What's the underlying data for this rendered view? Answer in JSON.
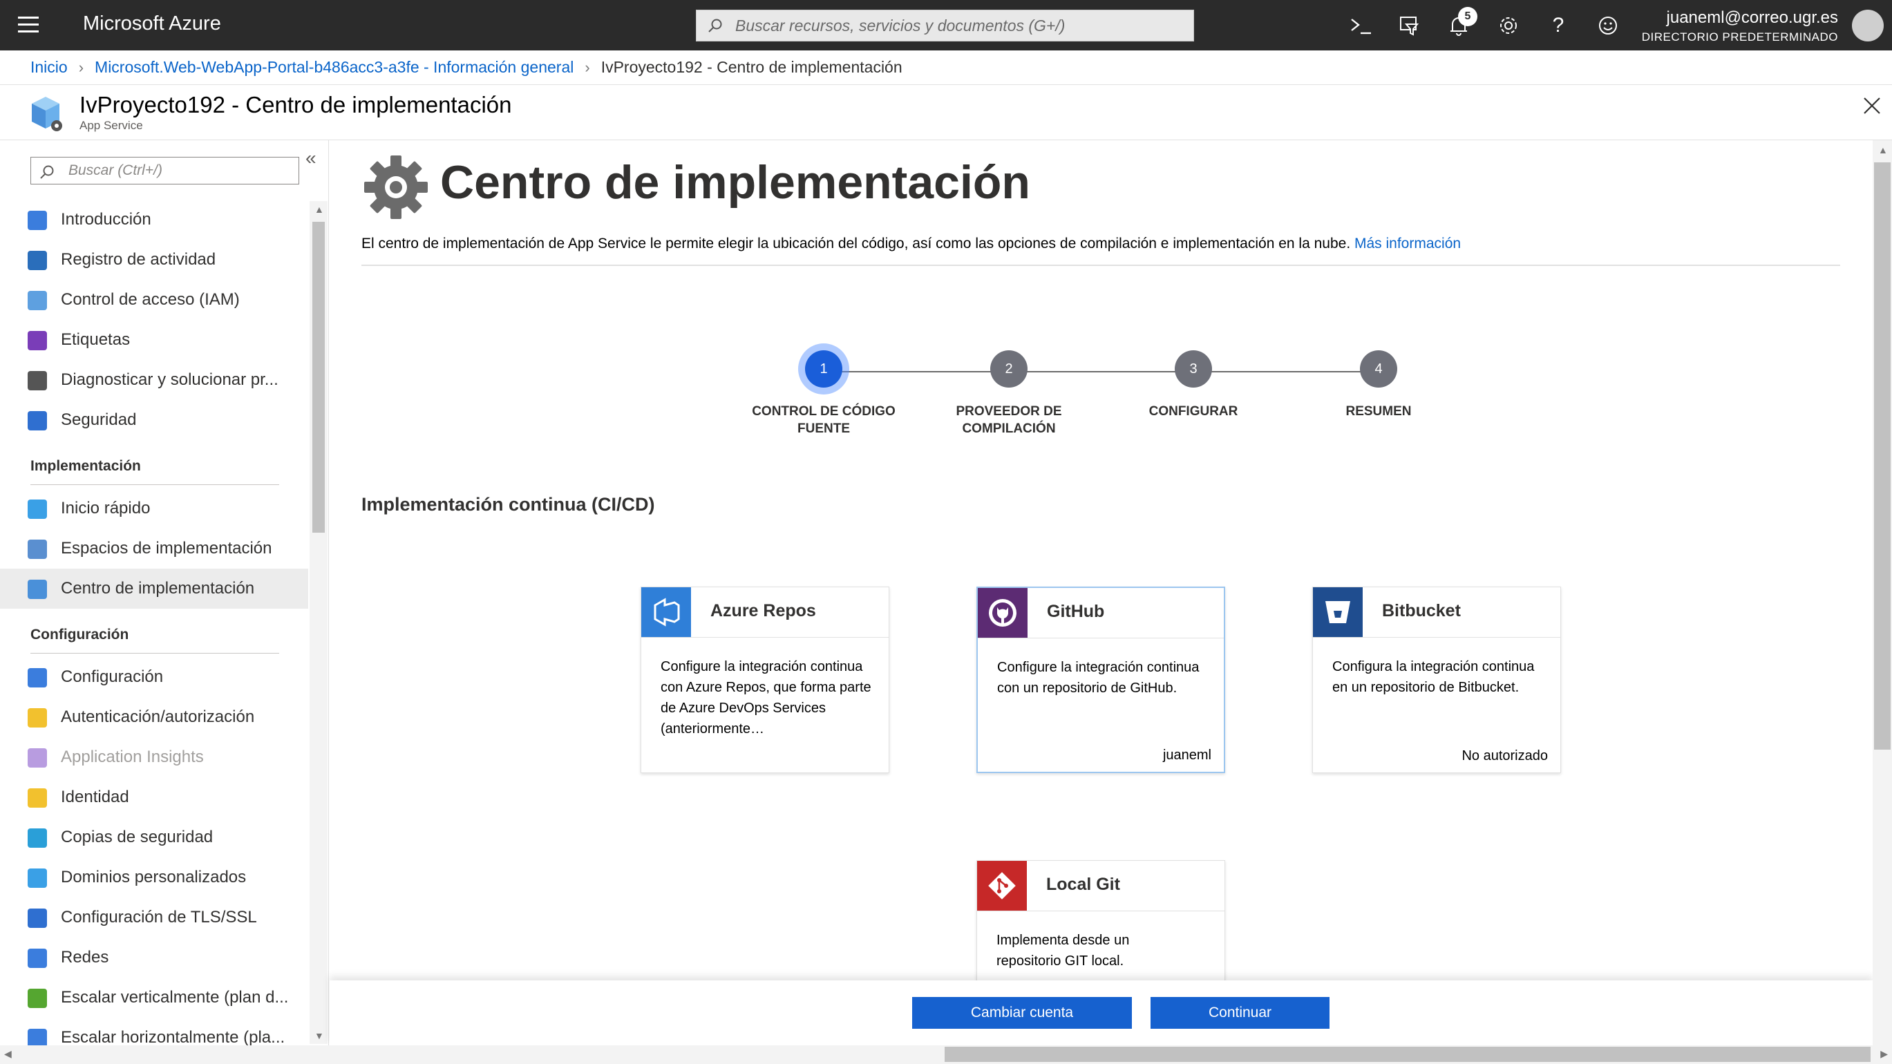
{
  "topbar": {
    "brand": "Microsoft Azure",
    "search_placeholder": "Buscar recursos, servicios y documentos (G+/)",
    "notifications_count": "5",
    "user_email": "juaneml@correo.ugr.es",
    "user_directory": "DIRECTORIO PREDETERMINADO",
    "icons": [
      "cloud-shell-icon",
      "directory-filter-icon",
      "bell-icon",
      "gear-icon",
      "help-icon",
      "feedback-smiley-icon"
    ]
  },
  "breadcrumb": {
    "home": "Inicio",
    "parent": "Microsoft.Web-WebApp-Portal-b486acc3-a3fe - Información general",
    "current": "IvProyecto192 - Centro de implementación"
  },
  "resource": {
    "title": "IvProyecto192 - Centro de implementación",
    "subtitle": "App Service"
  },
  "sidebar": {
    "search_placeholder": "Buscar (Ctrl+/)",
    "items_top": [
      {
        "label": "Introducción",
        "icon": "overview-icon",
        "color": "#3b7ddd"
      },
      {
        "label": "Registro de actividad",
        "icon": "activity-log-icon",
        "color": "#2a6ebb"
      },
      {
        "label": "Control de acceso (IAM)",
        "icon": "iam-icon",
        "color": "#5ea0e0"
      },
      {
        "label": "Etiquetas",
        "icon": "tag-icon",
        "color": "#7a3db8"
      },
      {
        "label": "Diagnosticar y solucionar pr...",
        "icon": "wrench-icon",
        "color": "#555555"
      },
      {
        "label": "Seguridad",
        "icon": "shield-icon",
        "color": "#2f6fd0"
      }
    ],
    "group_impl": "Implementación",
    "items_impl": [
      {
        "label": "Inicio rápido",
        "icon": "quickstart-icon",
        "color": "#3aa0e6"
      },
      {
        "label": "Espacios de implementación",
        "icon": "deployment-slots-icon",
        "color": "#5a8fd0"
      },
      {
        "label": "Centro de implementación",
        "icon": "deployment-center-icon",
        "color": "#4a90d9"
      }
    ],
    "group_config": "Configuración",
    "items_config": [
      {
        "label": "Configuración",
        "icon": "config-sliders-icon",
        "color": "#3b7ddd"
      },
      {
        "label": "Autenticación/autorización",
        "icon": "key-icon",
        "color": "#f2c12e"
      },
      {
        "label": "Application Insights",
        "icon": "insights-bulb-icon",
        "color": "#b89ce0"
      },
      {
        "label": "Identidad",
        "icon": "identity-icon",
        "color": "#f2c12e"
      },
      {
        "label": "Copias de seguridad",
        "icon": "backup-icon",
        "color": "#2a9fd8"
      },
      {
        "label": "Dominios personalizados",
        "icon": "domains-icon",
        "color": "#3aa0e6"
      },
      {
        "label": "Configuración de TLS/SSL",
        "icon": "tls-shield-icon",
        "color": "#2f6fd0"
      },
      {
        "label": "Redes",
        "icon": "network-icon",
        "color": "#3b7ddd"
      },
      {
        "label": "Escalar verticalmente (plan d...",
        "icon": "scale-up-icon",
        "color": "#55a630"
      },
      {
        "label": "Escalar horizontalmente (pla...",
        "icon": "scale-out-icon",
        "color": "#3b7ddd"
      }
    ]
  },
  "main": {
    "title": "Centro de implementación",
    "intro": "El centro de implementación de App Service le permite elegir la ubicación del código, así como las opciones de compilación e implementación en la nube.",
    "intro_link": "Más información",
    "steps": [
      {
        "num": "1",
        "label": "CONTROL DE CÓDIGO FUENTE",
        "active": true
      },
      {
        "num": "2",
        "label": "PROVEEDOR DE COMPILACIÓN",
        "active": false
      },
      {
        "num": "3",
        "label": "CONFIGURAR",
        "active": false
      },
      {
        "num": "4",
        "label": "RESUMEN",
        "active": false
      }
    ],
    "section_title": "Implementación continua (CI/CD)",
    "cards": [
      {
        "title": "Azure Repos",
        "desc": "Configure la integración continua con Azure Repos, que forma parte de Azure DevOps Services (anteriormente…",
        "status": "",
        "icon": "azure-repos-icon",
        "color": "#2f7fd8"
      },
      {
        "title": "GitHub",
        "desc": "Configure la integración continua con un repositorio de GitHub.",
        "status": "juaneml",
        "icon": "github-icon",
        "color": "#5c2b73"
      },
      {
        "title": "Bitbucket",
        "desc": "Configura la integración continua en un repositorio de Bitbucket.",
        "status": "No autorizado",
        "icon": "bitbucket-icon",
        "color": "#1f4d8f"
      },
      {
        "title": "Local Git",
        "desc": "Implementa desde un repositorio GIT local.",
        "status": "",
        "icon": "git-icon",
        "color": "#c62828"
      }
    ]
  },
  "footer": {
    "change_account": "Cambiar cuenta",
    "continue": "Continuar"
  }
}
